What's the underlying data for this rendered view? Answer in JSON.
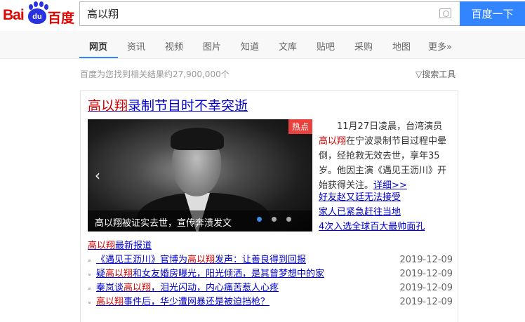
{
  "logo": {
    "text": "Baidu百度",
    "bai": "Bai",
    "du": "du",
    "cn": "百度"
  },
  "search": {
    "value": "高以翔",
    "button": "百度一下"
  },
  "nav": {
    "items": [
      "网页",
      "资讯",
      "视频",
      "图片",
      "知道",
      "文库",
      "贴吧",
      "采购",
      "地图",
      "更多»"
    ]
  },
  "result_count": "百度为您找到相关结果约27,900,000个",
  "search_tools": "▽搜索工具",
  "card": {
    "title_hl": "高以翔",
    "title_rest": "录制节目时不幸突逝",
    "badge": "热点",
    "caption": "高以翔被证实去世，宣传奔溃发文",
    "carousel": {
      "active": 1,
      "total": 3
    },
    "desc_1": "11月27日凌晨，台湾演员",
    "desc_hl": "高以翔",
    "desc_2": "在宁波录制节目过程中晕倒，经抢救无效去世，享年35岁。他因主演《遇见王沥川》开始获得关注。",
    "more": "详细>>",
    "links": [
      "好友赵又廷无法接受",
      "家人已紧急赶往当地",
      "4次入选全球百大最帅面孔"
    ],
    "news_hl": "高以翔",
    "news_rest": "最新报道",
    "news": [
      {
        "a": "《遇见王沥川》官博为",
        "h": "高以翔",
        "b": "发声：让善良得到回报",
        "date": "2019-12-09"
      },
      {
        "a": "疑",
        "h": "高以翔",
        "b": "和女友婚房曝光，阳光倾洒，是其曾梦想中的家",
        "date": "2019-12-09"
      },
      {
        "a": "秦岚谈",
        "h": "高以翔",
        "b": "，泪光闪动，内心痛苦惹人心疼",
        "date": "2019-12-09"
      },
      {
        "a": "",
        "h": "高以翔",
        "b": "事件后，华少遭网暴还是被迫挡枪？",
        "date": "2019-12-09"
      }
    ]
  },
  "colors": {
    "accent": "#3385ff",
    "link": "#0000cc",
    "highlight": "#cc0000",
    "badge": "#e8423e"
  }
}
